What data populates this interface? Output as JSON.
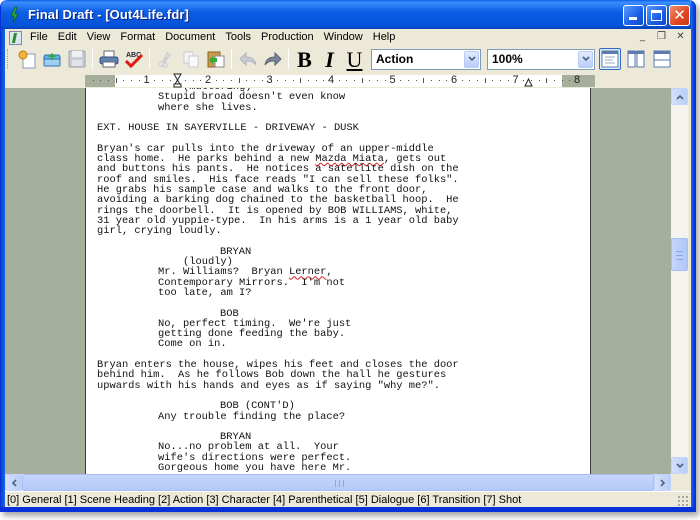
{
  "window": {
    "title": "Final Draft - [Out4Life.fdr]"
  },
  "menubar": {
    "items": [
      "File",
      "Edit",
      "View",
      "Format",
      "Document",
      "Tools",
      "Production",
      "Window",
      "Help"
    ]
  },
  "toolbar": {
    "buttons": [
      {
        "name": "new-document",
        "icon": "new-document-icon"
      },
      {
        "name": "open",
        "icon": "open-folder-icon"
      },
      {
        "name": "save",
        "icon": "floppy-disk-icon"
      },
      {
        "name": "print",
        "icon": "printer-icon"
      },
      {
        "name": "spelling",
        "icon": "abc-spellcheck-icon"
      },
      {
        "name": "cut",
        "icon": "scissors-icon",
        "disabled": true
      },
      {
        "name": "copy",
        "icon": "copy-icon",
        "disabled": true
      },
      {
        "name": "paste",
        "icon": "paste-icon"
      },
      {
        "name": "undo",
        "icon": "undo-arrow-icon",
        "disabled": true
      },
      {
        "name": "redo",
        "icon": "redo-arrow-icon"
      }
    ],
    "bold_label": "B",
    "italic_label": "I",
    "underline_label": "U",
    "element_select": "Action",
    "zoom_select": "100%",
    "view_modes": [
      {
        "name": "normal-view",
        "active": true
      },
      {
        "name": "page-view",
        "active": false
      },
      {
        "name": "speed-view",
        "active": false
      }
    ]
  },
  "ruler": {
    "numbers": [
      "1",
      "2",
      "3",
      "4",
      "5",
      "6",
      "7",
      "8"
    ]
  },
  "script": {
    "lines": [
      {
        "type": "par",
        "text": "(muttering)"
      },
      {
        "type": "dlg",
        "text": "Stupid broad doesn't even know"
      },
      {
        "type": "dlg",
        "text": "where she lives."
      },
      {
        "type": "blank",
        "text": ""
      },
      {
        "type": "scene",
        "text": "EXT. HOUSE IN SAYERVILLE - DRIVEWAY - DUSK"
      },
      {
        "type": "blank",
        "text": ""
      },
      {
        "type": "action",
        "text": "Bryan's car pulls into the driveway of an upper-middle"
      },
      {
        "type": "action",
        "text": "class home.  He parks behind a new ",
        "squiggle": "Mazda Miata",
        "after": ", gets out"
      },
      {
        "type": "action",
        "text": "and buttons his pants.  He notices a satellite dish on the"
      },
      {
        "type": "action",
        "text": "roof and smiles.  His face reads \"I can sell these folks\"."
      },
      {
        "type": "action",
        "text": "He grabs his sample case and walks to the front door,"
      },
      {
        "type": "action",
        "text": "avoiding a barking dog chained to the basketball hoop.  He"
      },
      {
        "type": "action",
        "text": "rings the doorbell.  It is opened by BOB WILLIAMS, white,"
      },
      {
        "type": "action",
        "text": "31 year old yuppie-type.  In his arms is a 1 year old baby"
      },
      {
        "type": "action",
        "text": "girl, crying loudly."
      },
      {
        "type": "blank",
        "text": ""
      },
      {
        "type": "chr",
        "text": "BRYAN"
      },
      {
        "type": "par",
        "text": "(loudly)"
      },
      {
        "type": "dlg",
        "text": "Mr. Williams?  Bryan ",
        "squiggle": "Lerner",
        "after": ","
      },
      {
        "type": "dlg",
        "text": "Contemporary Mirrors.  I'm not"
      },
      {
        "type": "dlg",
        "text": "too late, am I?"
      },
      {
        "type": "blank",
        "text": ""
      },
      {
        "type": "chr",
        "text": "BOB"
      },
      {
        "type": "dlg",
        "text": "No, perfect timing.  We're just"
      },
      {
        "type": "dlg",
        "text": "getting done feeding the baby."
      },
      {
        "type": "dlg",
        "text": "Come on in."
      },
      {
        "type": "blank",
        "text": ""
      },
      {
        "type": "action",
        "text": "Bryan enters the house, wipes his feet and closes the door"
      },
      {
        "type": "action",
        "text": "behind him.  As he follows Bob down the hall he gestures"
      },
      {
        "type": "action",
        "text": "upwards with his hands and eyes as if saying \"why me?\"."
      },
      {
        "type": "blank",
        "text": ""
      },
      {
        "type": "chr",
        "text": "BOB (CONT'D)"
      },
      {
        "type": "dlg",
        "text": "Any trouble finding the place?"
      },
      {
        "type": "blank",
        "text": ""
      },
      {
        "type": "chr",
        "text": "BRYAN"
      },
      {
        "type": "dlg",
        "text": "No...no problem at all.  Your"
      },
      {
        "type": "dlg",
        "text": "wife's directions were perfect."
      },
      {
        "type": "dlg",
        "text": "Gorgeous home you have here Mr."
      }
    ]
  },
  "statusbar": {
    "text": "[0] General [1] Scene Heading [2] Action [3] Character [4] Parenthetical [5] Dialogue [6] Transition [7] Shot"
  }
}
